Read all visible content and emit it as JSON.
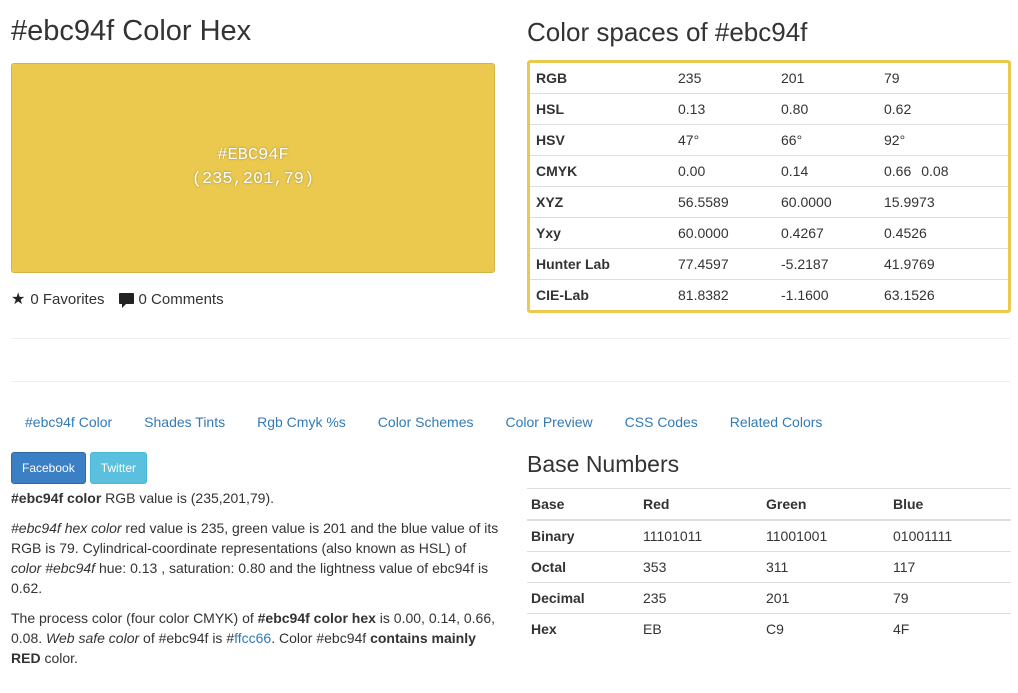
{
  "colors": {
    "swatch": "#ebc94f",
    "link": "#337ab7",
    "facebook": "#3b7fc4",
    "twitter": "#5bc0de",
    "box_border": "#ebc94f"
  },
  "header": {
    "title": "#ebc94f Color Hex"
  },
  "swatch": {
    "hex_label": "#EBC94F",
    "rgb_label": "(235,201,79)"
  },
  "meta": {
    "favorites_icon": "star-icon",
    "favorites": "0 Favorites",
    "comments_icon": "comment-icon",
    "comments": "0 Comments"
  },
  "color_spaces": {
    "title": "Color spaces of #ebc94f",
    "rows": [
      {
        "label": "RGB",
        "v1": "235",
        "v2": "201",
        "v3": "79",
        "v4": ""
      },
      {
        "label": "HSL",
        "v1": "0.13",
        "v2": "0.80",
        "v3": "0.62",
        "v4": ""
      },
      {
        "label": "HSV",
        "v1": "47°",
        "v2": "66°",
        "v3": "92°",
        "v4": ""
      },
      {
        "label": "CMYK",
        "v1": "0.00",
        "v2": "0.14",
        "v3": "0.66",
        "v4": "0.08"
      },
      {
        "label": "XYZ",
        "v1": "56.5589",
        "v2": "60.0000",
        "v3": "15.9973",
        "v4": ""
      },
      {
        "label": "Yxy",
        "v1": "60.0000",
        "v2": "0.4267",
        "v3": "0.4526",
        "v4": ""
      },
      {
        "label": "Hunter Lab",
        "v1": "77.4597",
        "v2": "-5.2187",
        "v3": "41.9769",
        "v4": ""
      },
      {
        "label": "CIE-Lab",
        "v1": "81.8382",
        "v2": "-1.1600",
        "v3": "63.1526",
        "v4": ""
      }
    ]
  },
  "tabs": [
    {
      "label": "#ebc94f Color"
    },
    {
      "label": "Shades Tints"
    },
    {
      "label": "Rgb Cmyk %s"
    },
    {
      "label": "Color Schemes"
    },
    {
      "label": "Color Preview"
    },
    {
      "label": "CSS Codes"
    },
    {
      "label": "Related Colors"
    }
  ],
  "share": {
    "facebook": "Facebook",
    "twitter": "Twitter"
  },
  "description": {
    "p1_bold": "#ebc94f color",
    "p1_rest": " RGB value is (235,201,79).",
    "p2_i1": "#ebc94f hex color",
    "p2_t1": " red value is 235, green value is 201 and the blue value of its RGB is 79. Cylindrical-coordinate representations (also known as HSL) of ",
    "p2_i2": "color #ebc94f",
    "p2_t2": " hue: 0.13 , saturation: 0.80 and the lightness value of ebc94f is 0.62.",
    "p3_t1": "The process color (four color CMYK) of ",
    "p3_b1": "#ebc94f color hex",
    "p3_t2": " is 0.00, 0.14, 0.66, 0.08. ",
    "p3_i1": "Web safe color",
    "p3_t3": " of #ebc94f is #",
    "p3_link": "ffcc66",
    "p3_t4": ". Color #ebc94f ",
    "p3_b2": "contains mainly RED",
    "p3_t5": " color."
  },
  "base_numbers": {
    "title": "Base Numbers",
    "headers": [
      "Base",
      "Red",
      "Green",
      "Blue"
    ],
    "rows": [
      {
        "label": "Binary",
        "r": "11101011",
        "g": "11001001",
        "b": "01001111"
      },
      {
        "label": "Octal",
        "r": "353",
        "g": "311",
        "b": "117"
      },
      {
        "label": "Decimal",
        "r": "235",
        "g": "201",
        "b": "79"
      },
      {
        "label": "Hex",
        "r": "EB",
        "g": "C9",
        "b": "4F"
      }
    ]
  }
}
